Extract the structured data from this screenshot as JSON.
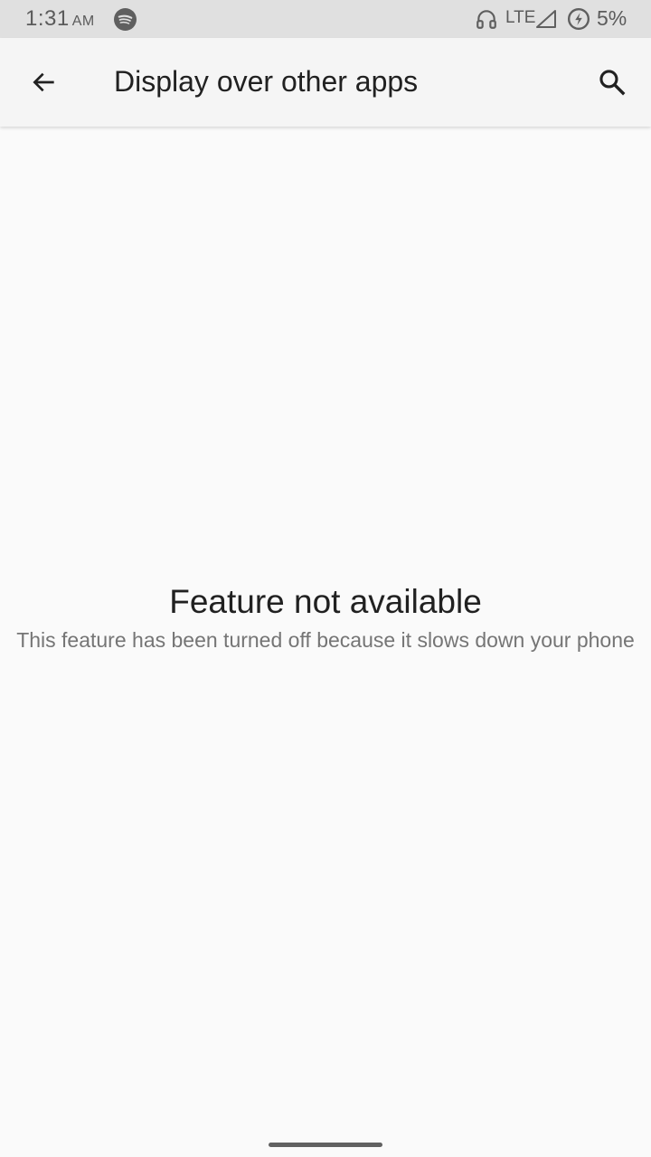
{
  "status_bar": {
    "time": "1:31",
    "ampm": "AM",
    "network_type": "LTE",
    "battery_percent": "5%",
    "icons": [
      "spotify-icon",
      "headphones-icon",
      "signal-icon",
      "battery-saver-icon"
    ]
  },
  "app_bar": {
    "title": "Display over other apps",
    "back_icon": "arrow-back-icon",
    "search_icon": "search-icon"
  },
  "empty_state": {
    "title": "Feature not available",
    "message": "This feature has been turned off because it slows down your phone"
  },
  "colors": {
    "status_bar_bg": "#e0e0e0",
    "app_bar_bg": "#f5f5f5",
    "page_bg": "#fafafa",
    "primary_text": "#212121",
    "secondary_text": "#757575"
  }
}
